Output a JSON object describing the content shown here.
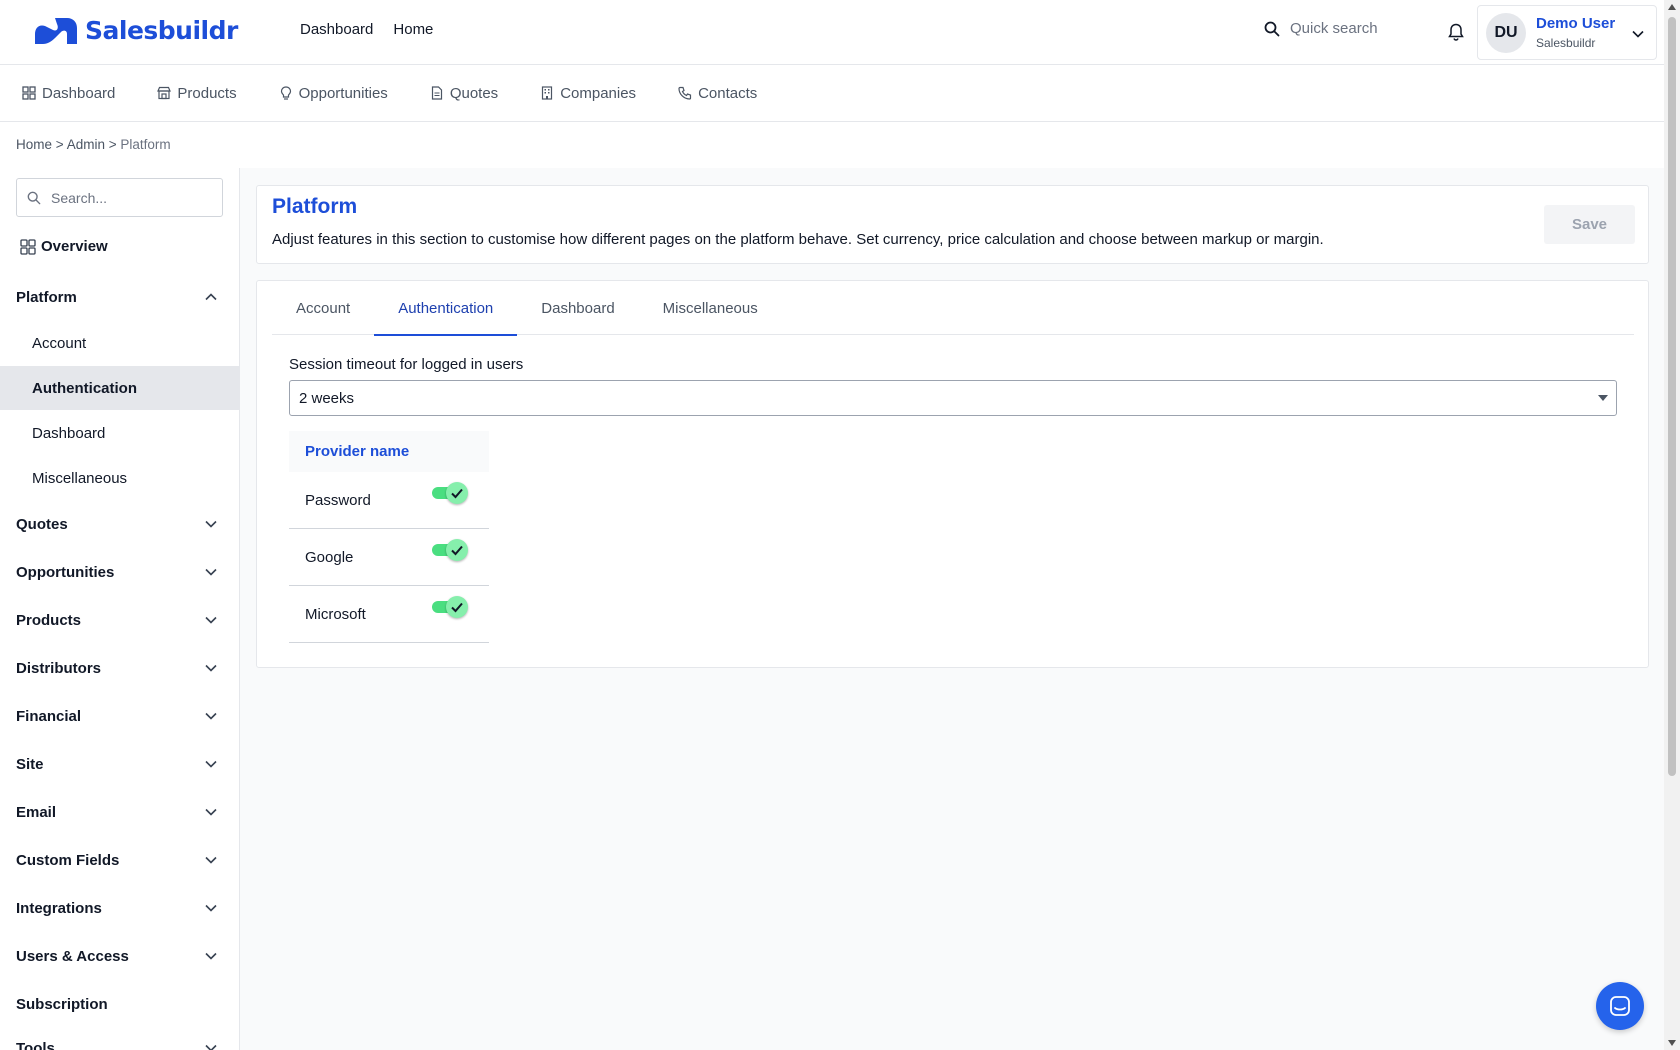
{
  "brand": {
    "name": "Salesbuildr",
    "color": "#1d4ed8"
  },
  "topnav": {
    "items": [
      "Dashboard",
      "Home"
    ]
  },
  "quicksearch": {
    "placeholder": "Quick search"
  },
  "user": {
    "initials": "DU",
    "name": "Demo User",
    "org": "Salesbuildr"
  },
  "subnav": {
    "items": [
      {
        "label": "Dashboard",
        "icon": "grid-icon"
      },
      {
        "label": "Products",
        "icon": "store-icon"
      },
      {
        "label": "Opportunities",
        "icon": "lightbulb-icon"
      },
      {
        "label": "Quotes",
        "icon": "document-icon"
      },
      {
        "label": "Companies",
        "icon": "building-icon"
      },
      {
        "label": "Contacts",
        "icon": "phone-icon"
      }
    ]
  },
  "breadcrumb": {
    "home": "Home",
    "sep": ">",
    "admin": "Admin",
    "current": "Platform"
  },
  "sidebar": {
    "search_placeholder": "Search...",
    "overview": "Overview",
    "platform": {
      "label": "Platform",
      "items": [
        "Account",
        "Authentication",
        "Dashboard",
        "Miscellaneous"
      ],
      "active": "Authentication"
    },
    "sections": [
      "Quotes",
      "Opportunities",
      "Products",
      "Distributors",
      "Financial",
      "Site",
      "Email",
      "Custom Fields",
      "Integrations",
      "Users & Access",
      "Subscription",
      "Tools"
    ]
  },
  "page": {
    "title": "Platform",
    "description": "Adjust features in this section to customise how different pages on the platform behave. Set currency, price calculation and choose between markup or margin.",
    "save_label": "Save"
  },
  "tabs": {
    "items": [
      "Account",
      "Authentication",
      "Dashboard",
      "Miscellaneous"
    ],
    "active": "Authentication"
  },
  "session": {
    "label": "Session timeout for logged in users",
    "value": "2 weeks"
  },
  "providers": {
    "header": "Provider name",
    "rows": [
      {
        "name": "Password",
        "enabled": true
      },
      {
        "name": "Google",
        "enabled": true
      },
      {
        "name": "Microsoft",
        "enabled": true
      }
    ]
  },
  "colors": {
    "toggle_on": "#4ade80",
    "accent": "#1d4ed8",
    "active_bg": "#e5e7eb"
  }
}
